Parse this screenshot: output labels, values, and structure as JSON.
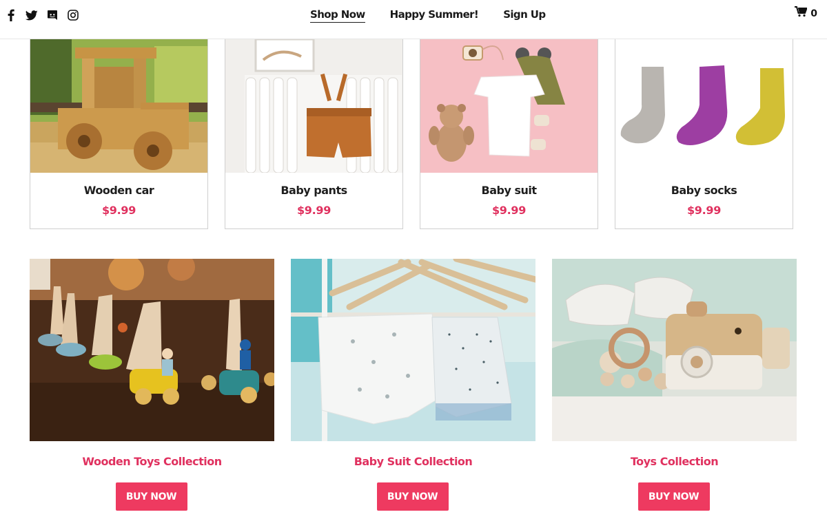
{
  "header": {
    "social": [
      {
        "icon": "facebook-icon"
      },
      {
        "icon": "twitter-icon"
      },
      {
        "icon": "discord-icon"
      },
      {
        "icon": "instagram-icon"
      }
    ],
    "nav": [
      {
        "label": "Shop Now",
        "active": true
      },
      {
        "label": "Happy Summer!",
        "active": false
      },
      {
        "label": "Sign Up",
        "active": false
      }
    ],
    "cart": {
      "icon": "shopping-cart-icon",
      "count": "0"
    }
  },
  "products": [
    {
      "name": "Wooden car",
      "price": "$9.99"
    },
    {
      "name": "Baby pants",
      "price": "$9.99"
    },
    {
      "name": "Baby suit",
      "price": "$9.99"
    },
    {
      "name": "Baby socks",
      "price": "$9.99"
    }
  ],
  "collections": [
    {
      "title": "Wooden Toys Collection",
      "button": "BUY NOW"
    },
    {
      "title": "Baby Suit Collection",
      "button": "BUY NOW"
    },
    {
      "title": "Toys Collection",
      "button": "BUY NOW"
    }
  ],
  "colors": {
    "accent": "#ee3a60",
    "price": "#e0315f",
    "text": "#1e1e1e",
    "border": "#cfcfcf"
  }
}
